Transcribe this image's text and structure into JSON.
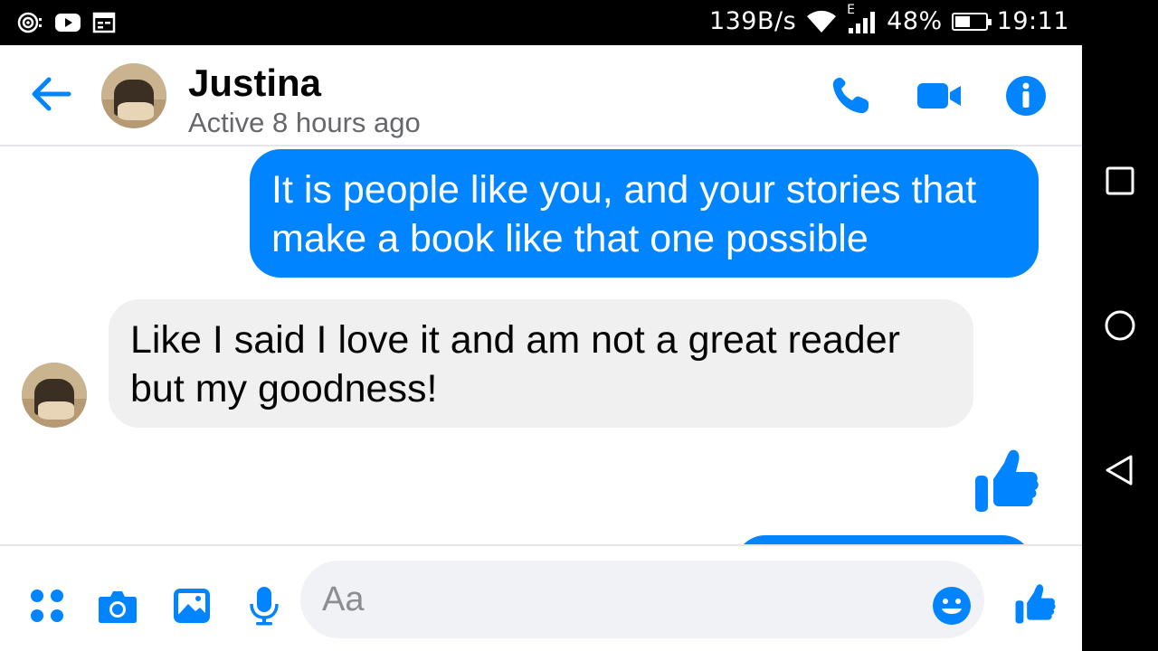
{
  "status_bar": {
    "speed": "139B/s",
    "network_type": "E",
    "battery_pct": "48%",
    "battery_level": 0.48,
    "time": "19:11",
    "left_icons": [
      "hotspot-icon",
      "youtube-icon",
      "calendar-icon"
    ]
  },
  "header": {
    "contact_name": "Justina",
    "active_status": "Active 8 hours ago",
    "icons": [
      "back-arrow-icon",
      "phone-icon",
      "video-icon",
      "info-icon"
    ]
  },
  "messages": [
    {
      "direction": "outgoing",
      "text": "It is people like you, and your stories that make a book like that one possible"
    },
    {
      "direction": "incoming",
      "text": "Like I said I love it and am not a great reader but my goodness!"
    },
    {
      "direction": "outgoing",
      "type": "like",
      "icon": "thumbs-up-icon"
    }
  ],
  "composer": {
    "placeholder": "Aa",
    "icons": [
      "apps-icon",
      "camera-icon",
      "gallery-icon",
      "microphone-icon",
      "emoji-icon",
      "thumbs-up-icon"
    ]
  },
  "colors": {
    "accent": "#0084ff",
    "incoming_bubble": "#f0f0f0",
    "secondary_text": "#65676b"
  }
}
